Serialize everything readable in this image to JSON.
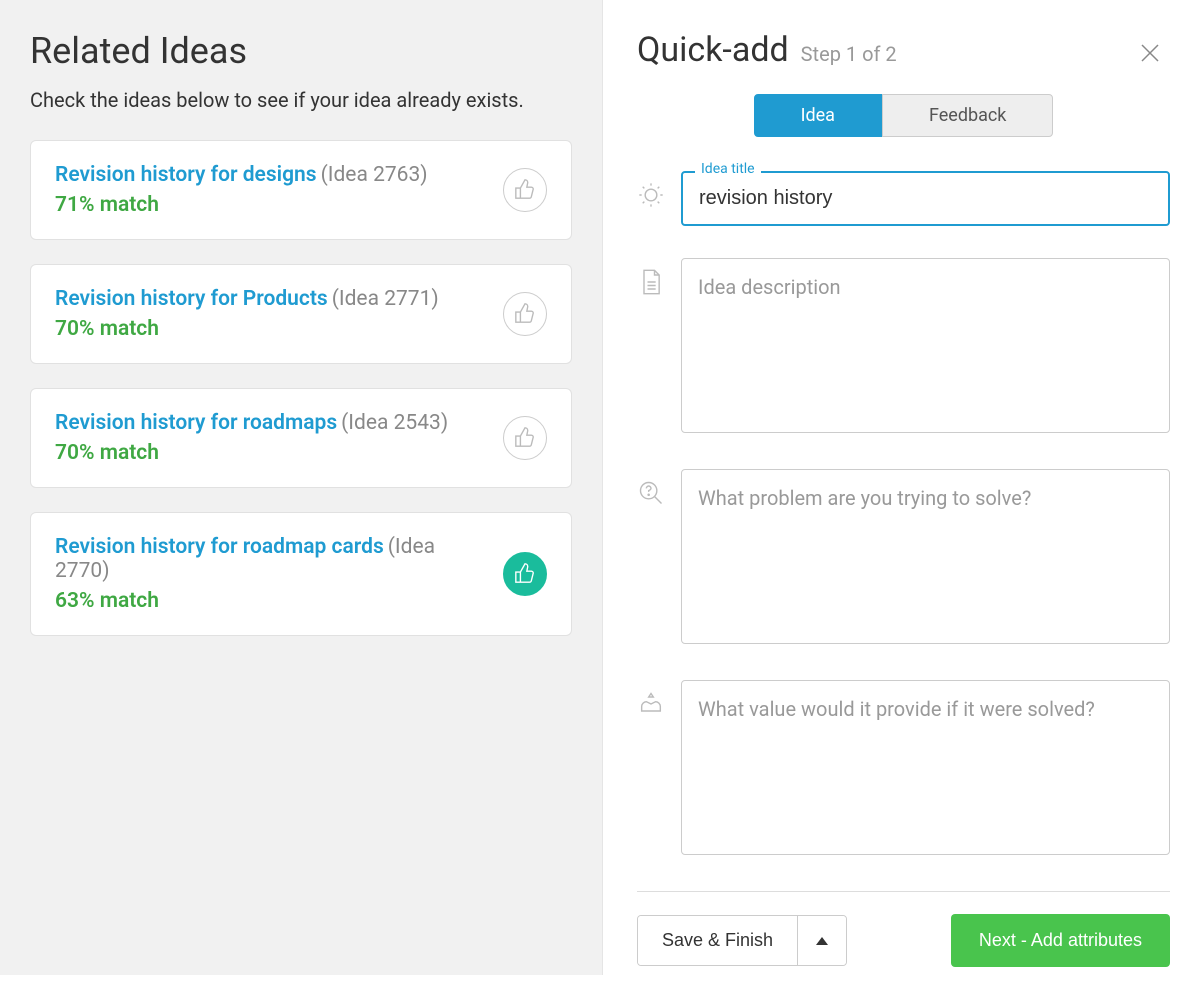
{
  "left": {
    "title": "Related Ideas",
    "subtitle": "Check the ideas below to see if your idea already exists.",
    "ideas": [
      {
        "title": "Revision history for designs",
        "ref": "(Idea 2763)",
        "match": "71% match",
        "liked": false
      },
      {
        "title": "Revision history for Products",
        "ref": "(Idea 2771)",
        "match": "70% match",
        "liked": false
      },
      {
        "title": "Revision history for roadmaps",
        "ref": "(Idea 2543)",
        "match": "70% match",
        "liked": false
      },
      {
        "title": "Revision history for roadmap cards",
        "ref": "(Idea 2770)",
        "match": "63% match",
        "liked": true
      }
    ]
  },
  "right": {
    "title": "Quick-add",
    "step": "Step 1 of 2",
    "tabs": {
      "idea": "Idea",
      "feedback": "Feedback"
    },
    "form": {
      "title_label": "Idea title",
      "title_value": "revision history",
      "description_placeholder": "Idea description",
      "problem_placeholder": "What problem are you trying to solve?",
      "value_placeholder": "What value would it provide if it were solved?"
    },
    "footer": {
      "save": "Save & Finish",
      "next": "Next - Add attributes"
    }
  }
}
